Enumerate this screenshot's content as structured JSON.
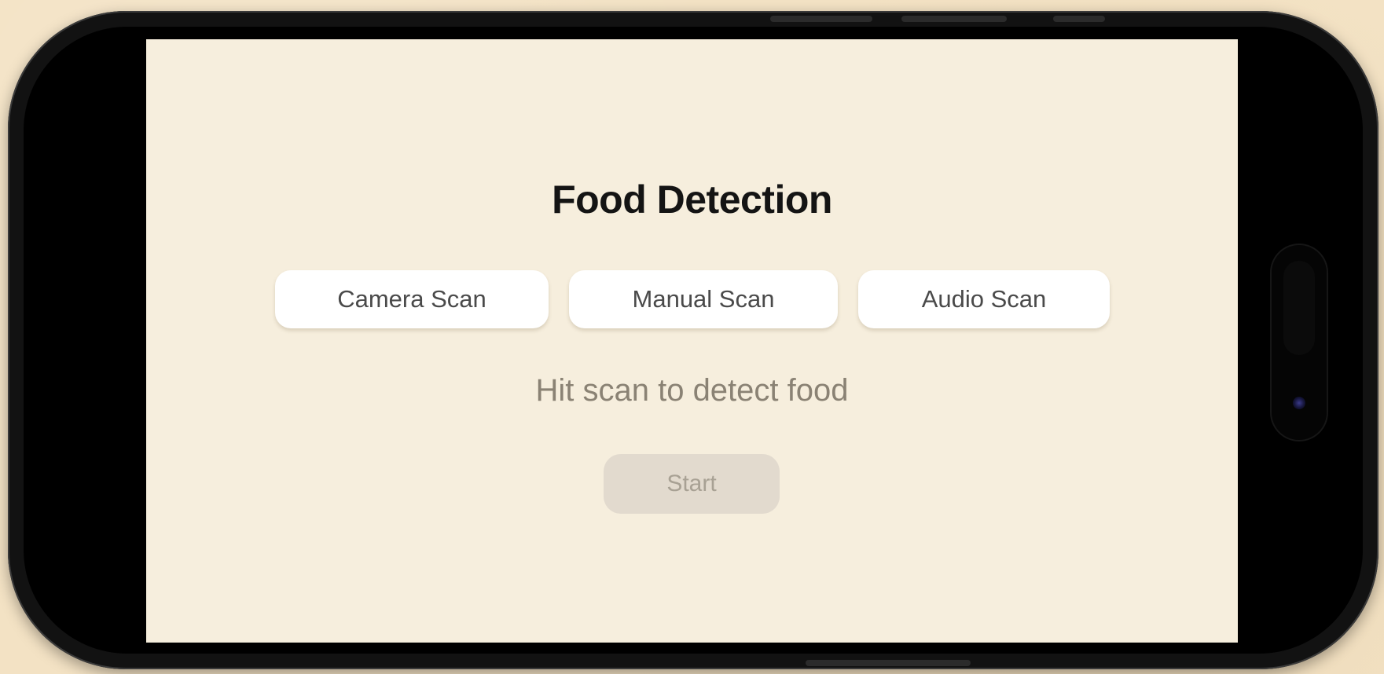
{
  "app": {
    "title": "Food Detection",
    "status": "Hit scan to detect food"
  },
  "scan_modes": [
    {
      "label": "Camera Scan"
    },
    {
      "label": "Manual Scan"
    },
    {
      "label": "Audio Scan"
    }
  ],
  "start_button": {
    "label": "Start",
    "state": "disabled"
  },
  "colors": {
    "screen_background": "#f6eedd",
    "mode_button_background": "#ffffff",
    "start_button_background": "#e2dace",
    "start_button_text": "#a8a194",
    "status_text": "#8a8274",
    "phone_frame": "#121212"
  }
}
